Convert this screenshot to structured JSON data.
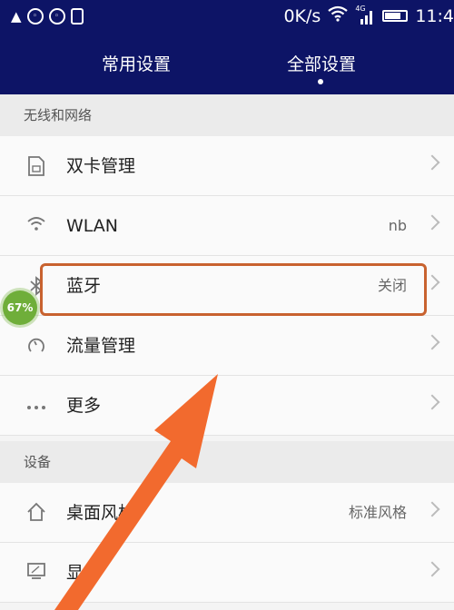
{
  "status_bar": {
    "speed": "0K/s",
    "network": "4G",
    "time": "11:4"
  },
  "tabs": [
    {
      "label": "常用设置",
      "active": false
    },
    {
      "label": "全部设置",
      "active": true
    }
  ],
  "sections": [
    {
      "title": "无线和网络",
      "items": [
        {
          "label": "双卡管理",
          "value": "",
          "icon": "sim-card-icon"
        },
        {
          "label": "WLAN",
          "value": "nb",
          "icon": "wifi-icon"
        },
        {
          "label": "蓝牙",
          "value": "关闭",
          "icon": "bluetooth-icon",
          "highlighted": true
        },
        {
          "label": "流量管理",
          "value": "",
          "icon": "data-usage-icon"
        },
        {
          "label": "更多",
          "value": "",
          "icon": "more-icon"
        }
      ]
    },
    {
      "title": "设备",
      "items": [
        {
          "label": "桌面风格",
          "value": "标准风格",
          "icon": "home-icon"
        },
        {
          "label": "显示",
          "value": "",
          "icon": "display-icon"
        }
      ]
    }
  ],
  "overlay": {
    "badge": "67%"
  },
  "colors": {
    "header": "#0d1466",
    "highlight": "#c8622f",
    "arrow": "#f26a2e",
    "badge": "#6fae3a"
  }
}
